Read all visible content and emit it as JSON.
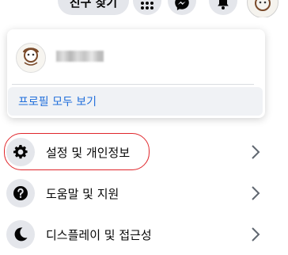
{
  "header": {
    "find_friends_label": "친구 찾기",
    "buttons": [
      {
        "name": "menu-grid",
        "icon": "grid-icon"
      },
      {
        "name": "messenger",
        "icon": "messenger-icon"
      },
      {
        "name": "notifications",
        "icon": "bell-icon"
      },
      {
        "name": "account",
        "icon": "avatar"
      }
    ]
  },
  "profile_card": {
    "see_all_profiles_label": "프로필 모두 보기"
  },
  "menu": {
    "items": [
      {
        "label": "설정 및 개인정보",
        "icon": "gear-icon"
      },
      {
        "label": "도움말 및 지원",
        "icon": "question-icon"
      },
      {
        "label": "디스플레이 및 접근성",
        "icon": "moon-icon"
      }
    ]
  },
  "colors": {
    "link": "#216fdb",
    "icon_bg": "#e4e6eb",
    "highlight": "#e0262b"
  }
}
